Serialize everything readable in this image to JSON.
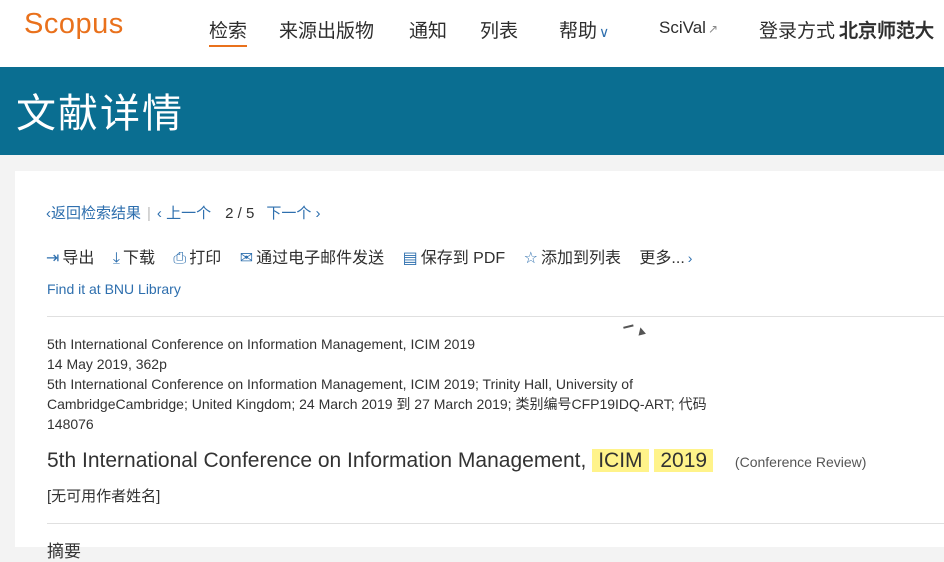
{
  "nav": {
    "logo": "Scopus",
    "search": "检索",
    "sources": "来源出版物",
    "alerts": "通知",
    "lists": "列表",
    "help": "帮助",
    "help_chevron": "∨",
    "scival": "SciVal",
    "scival_icon": "↗",
    "login_label": "登录方式",
    "institution": "北京师范大"
  },
  "header": {
    "title": "文献详情"
  },
  "pager": {
    "back": "返回检索结果",
    "prev": "上一个",
    "current": "2",
    "total": "5",
    "next": "下一个"
  },
  "toolbar": {
    "export": "导出",
    "download": "下载",
    "print": "打印",
    "email": "通过电子邮件发送",
    "save_pdf": "保存到 PDF",
    "add_list": "添加到列表",
    "more": "更多..."
  },
  "find_it": "Find it at BNU Library",
  "meta": {
    "line1": "5th International Conference on Information Management, ICIM 2019",
    "line2": "14 May 2019, 362p",
    "line3": "5th International Conference on Information Management, ICIM 2019; Trinity Hall, University of CambridgeCambridge; United Kingdom; 24 March 2019 到 27 March 2019; 类别编号CFP19IDQ-ART; 代码 148076"
  },
  "doc": {
    "title_main": "5th International Conference on Information Management,",
    "title_hl1": "ICIM",
    "title_hl2": "2019",
    "type": "(Conference Review)",
    "authors": "[无可用作者姓名]"
  },
  "abstract_heading": "摘要",
  "colors": {
    "brand": "#e9711c",
    "band": "#0a6e91",
    "link": "#2e6fae",
    "highlight": "#fff38a"
  }
}
